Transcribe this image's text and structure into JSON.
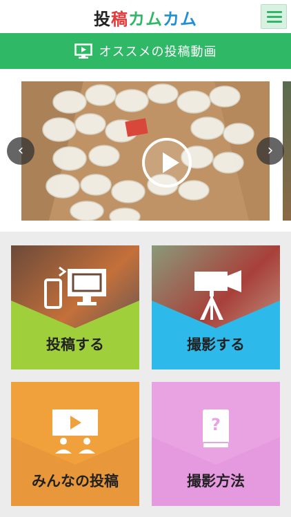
{
  "header": {
    "logo_part1": "投",
    "logo_part2": "稿",
    "logo_part3": "カム",
    "logo_part4": "カム",
    "menu_icon": "hamburger-menu-icon"
  },
  "banner": {
    "icon": "monitor-icon",
    "title": "オススメの投稿動画"
  },
  "carousel": {
    "prev_icon": "chevron-left-icon",
    "next_icon": "chevron-right-icon",
    "play_icon": "play-icon",
    "prev_glyph": "‹",
    "next_glyph": "›"
  },
  "tiles": [
    {
      "label": "投稿する",
      "color": "#9fd03c",
      "icon": "phone-to-monitor-icon"
    },
    {
      "label": "撮影する",
      "color": "#2db9ea",
      "icon": "video-camera-tripod-icon"
    },
    {
      "label": "みんなの投稿",
      "color": "#f0a13c",
      "icon": "audience-screen-icon"
    },
    {
      "label": "撮影方法",
      "color": "#e9a3e3",
      "icon": "help-book-icon"
    }
  ],
  "colors": {
    "brand_green": "#2fb866",
    "menu_bg": "#d9f1e2"
  }
}
